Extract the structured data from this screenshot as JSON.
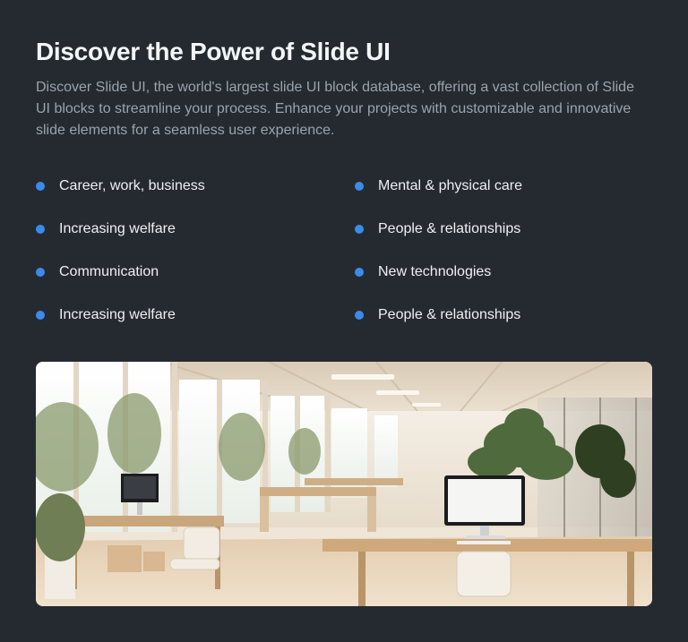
{
  "section": {
    "title": "Discover the Power of Slide UI",
    "description": "Discover Slide UI, the world's largest slide UI block database, offering a vast collection of Slide UI blocks to streamline your process. Enhance your projects with customizable and innovative slide elements for a seamless user experience."
  },
  "features": {
    "left": [
      "Career, work, business",
      "Increasing welfare",
      "Communication",
      "Increasing welfare"
    ],
    "right": [
      "Mental & physical care",
      "People & relationships",
      "New technologies",
      "People & relationships"
    ]
  },
  "colors": {
    "background": "#252a31",
    "accent": "#3b8beb",
    "title": "#f4f5f7",
    "body": "#9aa3ad"
  },
  "image": {
    "icon": "office-photo"
  }
}
